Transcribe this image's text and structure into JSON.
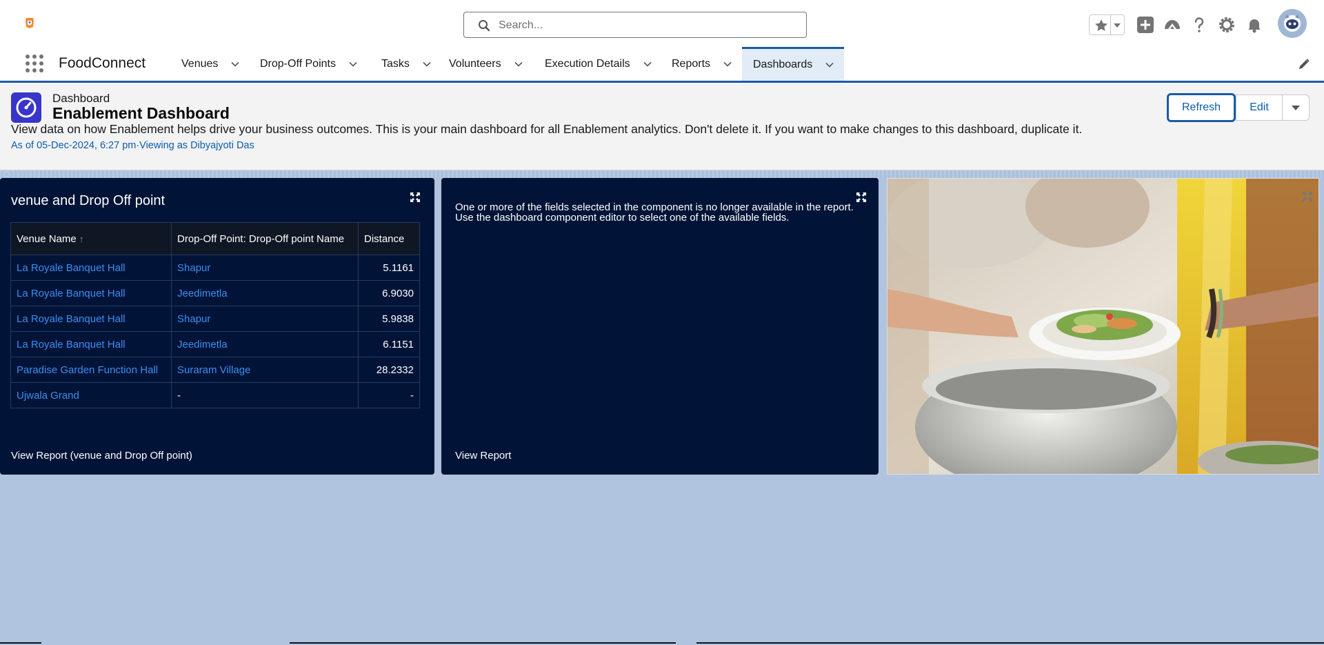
{
  "header": {
    "search_placeholder": "Search...",
    "colors": {
      "accent": "#1b5aa5",
      "link": "#0b5cab",
      "panel_bg": "#011437",
      "canvas_bg": "#b0c4df"
    }
  },
  "nav": {
    "app_name": "FoodConnect",
    "tabs": [
      {
        "label": "Venues"
      },
      {
        "label": "Drop-Off Points"
      },
      {
        "label": "Tasks"
      },
      {
        "label": "Volunteers"
      },
      {
        "label": "Execution Details"
      },
      {
        "label": "Reports"
      },
      {
        "label": "Dashboards",
        "active": true
      }
    ]
  },
  "dashboard": {
    "type_label": "Dashboard",
    "title": "Enablement Dashboard",
    "description": "View data on how Enablement helps drive your business outcomes. This is your main dashboard for all Enablement analytics. Don't delete it. If you want to make changes to this dashboard, duplicate it.",
    "meta": "As of 05-Dec-2024, 6:27 pm·Viewing as Dibyajyoti Das",
    "buttons": {
      "refresh": "Refresh",
      "edit": "Edit"
    }
  },
  "panel1": {
    "title": "venue and Drop Off point",
    "columns": [
      "Venue Name",
      "Drop-Off Point: Drop-Off point Name",
      "Distance"
    ],
    "sort_indicator": "↑",
    "rows": [
      {
        "venue": "La Royale Banquet Hall",
        "dropoff": "Shapur",
        "distance": "5.1161"
      },
      {
        "venue": "La Royale Banquet Hall",
        "dropoff": "Jeedimetla",
        "distance": "6.9030"
      },
      {
        "venue": "La Royale Banquet Hall",
        "dropoff": "Shapur",
        "distance": "5.9838"
      },
      {
        "venue": "La Royale Banquet Hall",
        "dropoff": "Jeedimetla",
        "distance": "6.1151"
      },
      {
        "venue": "Paradise Garden Function Hall",
        "dropoff": "Suraram Village",
        "distance": "28.2332"
      },
      {
        "venue": "Ujwala Grand",
        "dropoff": "-",
        "distance": "-"
      }
    ],
    "footer_link": "View Report (venue and Drop Off point)"
  },
  "panel2": {
    "error_line1": "One or more of the fields selected in the component is no longer available in the report.",
    "error_line2": "Use the dashboard component editor to select one of the available fields.",
    "footer_link": "View Report"
  }
}
